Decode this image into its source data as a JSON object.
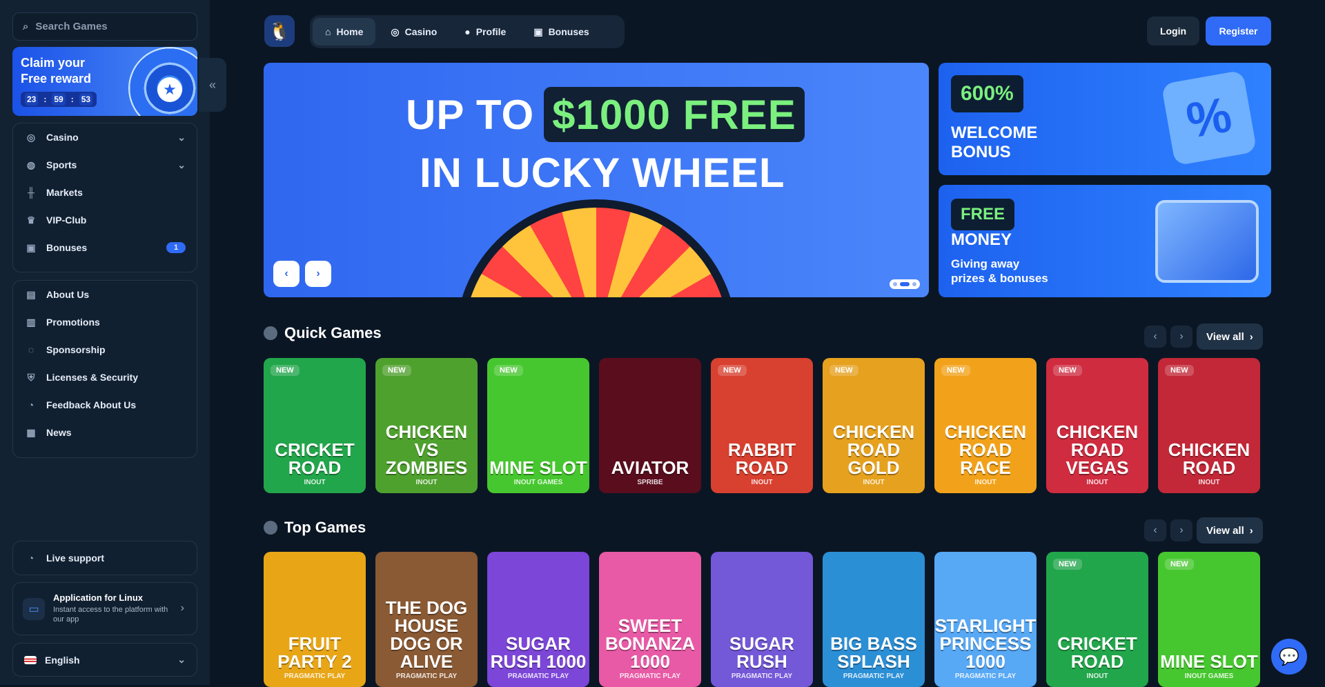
{
  "search": {
    "placeholder": "Search Games"
  },
  "promo": {
    "title_line1": "Claim your",
    "title_line2": "Free reward",
    "timer": [
      "23",
      "59",
      "53"
    ]
  },
  "sidebar": {
    "nav": [
      {
        "label": "Casino",
        "icon": "casino-icon",
        "chevron": true
      },
      {
        "label": "Sports",
        "icon": "globe-icon",
        "chevron": true
      },
      {
        "label": "Markets",
        "icon": "chart-icon",
        "chevron": false
      },
      {
        "label": "VIP-Club",
        "icon": "crown-icon",
        "chevron": false
      },
      {
        "label": "Bonuses",
        "icon": "gift-icon",
        "badge": "1"
      }
    ],
    "info": [
      {
        "label": "About Us",
        "icon": "book-icon"
      },
      {
        "label": "Promotions",
        "icon": "ticket-icon"
      },
      {
        "label": "Sponsorship",
        "icon": "trophy-icon"
      },
      {
        "label": "Licenses & Security",
        "icon": "shield-icon"
      },
      {
        "label": "Feedback About Us",
        "icon": "chat-icon"
      },
      {
        "label": "News",
        "icon": "news-icon"
      }
    ],
    "support_label": "Live support",
    "app": {
      "title": "Application for Linux",
      "desc": "Instant access to the platform with our app"
    },
    "language": "English"
  },
  "topnav": {
    "tabs": [
      "Home",
      "Casino",
      "Profile",
      "Bonuses"
    ]
  },
  "auth": {
    "login": "Login",
    "register": "Register"
  },
  "hero": {
    "prefix": "UP TO",
    "amount": "$1000 FREE",
    "line2": "IN LUCKY WHEEL"
  },
  "side_banners": {
    "welcome": {
      "chip": "600%",
      "title1": "WELCOME",
      "title2": "BONUS"
    },
    "free": {
      "chip": "FREE",
      "title": "MONEY",
      "sub1": "Giving away",
      "sub2": "prizes & bonuses"
    }
  },
  "sections": {
    "quick": "Quick Games",
    "top": "Top Games",
    "view_all": "View all"
  },
  "quick_games": [
    {
      "name": "CRICKET ROAD",
      "provider": "INOUT",
      "new": "NEW",
      "bg": "#22a64b"
    },
    {
      "name": "CHICKEN VS ZOMBIES",
      "provider": "INOUT",
      "new": "NEW",
      "bg": "#4fa12e"
    },
    {
      "name": "MINE SLOT",
      "provider": "INOUT GAMES",
      "new": "NEW",
      "bg": "#47c72f"
    },
    {
      "name": "AVIATOR",
      "provider": "SPRIBE",
      "new": "",
      "bg": "#5a0d1d"
    },
    {
      "name": "RABBIT ROAD",
      "provider": "INOUT",
      "new": "NEW",
      "bg": "#d8402f"
    },
    {
      "name": "CHICKEN ROAD GOLD",
      "provider": "INOUT",
      "new": "NEW",
      "bg": "#e6a11f"
    },
    {
      "name": "CHICKEN ROAD RACE",
      "provider": "INOUT",
      "new": "NEW",
      "bg": "#f2a21a"
    },
    {
      "name": "CHICKEN ROAD VEGAS",
      "provider": "INOUT",
      "new": "NEW",
      "bg": "#cf2c40"
    },
    {
      "name": "CHICKEN ROAD",
      "provider": "INOUT",
      "new": "NEW",
      "bg": "#c22838"
    }
  ],
  "top_games": [
    {
      "name": "FRUIT PARTY 2",
      "provider": "PRAGMATIC PLAY",
      "new": "",
      "bg": "#e8a617"
    },
    {
      "name": "THE DOG HOUSE DOG OR ALIVE",
      "provider": "PRAGMATIC PLAY",
      "new": "",
      "bg": "#8a5a34"
    },
    {
      "name": "SUGAR RUSH 1000",
      "provider": "PRAGMATIC PLAY",
      "new": "",
      "bg": "#7c46d8"
    },
    {
      "name": "SWEET BONANZA 1000",
      "provider": "PRAGMATIC PLAY",
      "new": "",
      "bg": "#e85aa6"
    },
    {
      "name": "SUGAR RUSH",
      "provider": "PRAGMATIC PLAY",
      "new": "",
      "bg": "#7358d8"
    },
    {
      "name": "BIG BASS SPLASH",
      "provider": "PRAGMATIC PLAY",
      "new": "",
      "bg": "#2b8fd6"
    },
    {
      "name": "STARLIGHT PRINCESS 1000",
      "provider": "PRAGMATIC PLAY",
      "new": "",
      "bg": "#57a8f5"
    },
    {
      "name": "CRICKET ROAD",
      "provider": "INOUT",
      "new": "NEW",
      "bg": "#22a64b"
    },
    {
      "name": "MINE SLOT",
      "provider": "INOUT GAMES",
      "new": "NEW",
      "bg": "#47c72f"
    }
  ]
}
